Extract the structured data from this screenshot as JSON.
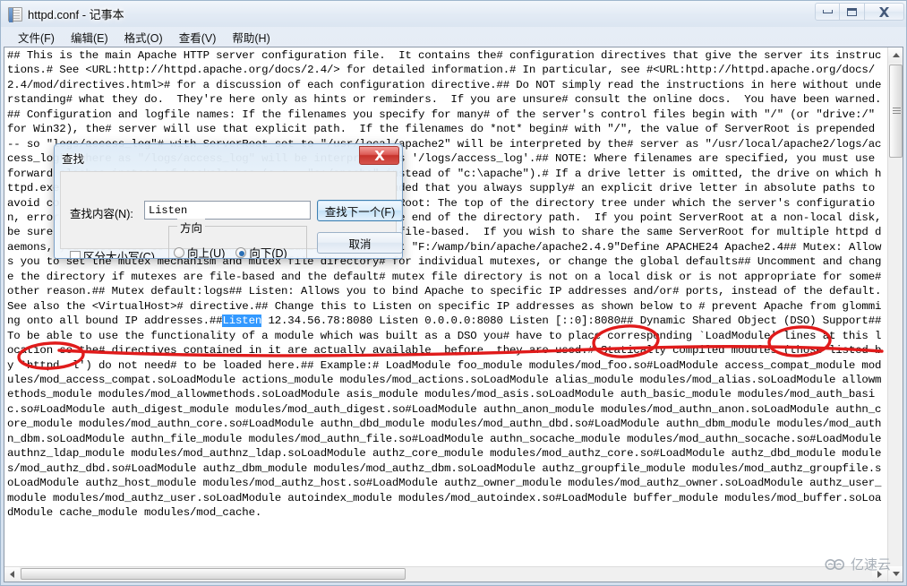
{
  "window": {
    "title": "httpd.conf - 记事本",
    "icon": "notepad-icon",
    "buttons": {
      "minimize": "–",
      "maximize": "□",
      "close": "✕"
    }
  },
  "menubar": {
    "items": [
      {
        "label": "文件(F)",
        "name": "menu-file"
      },
      {
        "label": "编辑(E)",
        "name": "menu-edit"
      },
      {
        "label": "格式(O)",
        "name": "menu-format"
      },
      {
        "label": "查看(V)",
        "name": "menu-view"
      },
      {
        "label": "帮助(H)",
        "name": "menu-help"
      }
    ]
  },
  "editor": {
    "text_before_match": "## This is the main Apache HTTP server configuration file.  It contains the# configuration directives that give the server its instructions.# See <URL:http://httpd.apache.org/docs/2.4/> for detailed information.# In particular, see #<URL:http://httpd.apache.org/docs/2.4/mod/directives.html># for a discussion of each configuration directive.## Do NOT simply read the instructions in here without understanding# what they do.  They're here only as hints or reminders.  If you are unsure# consult the online docs.  You have been warned.  ## Configuration and logfile names: If the filenames you specify for many# of the server's control files begin with \"/\" (or \"drive:/\" for Win32), the# server will use that explicit path.  If the filenames do *not* begin# with \"/\", the value of ServerRoot is prepended -- so \"logs/access_log\"# with ServerRoot set to \"/usr/local/apache2\" will be interpreted by the# server as \"/usr/local/apache2/logs/access_log\", where as \"/logs/access_log\" will be interpreted as '/logs/access_log'.## NOTE: Where filenames are specified, you must use forward slashes instead of backslashes (e.g., \"c:/apache\" instead of \"c:\\apache\").# If a drive letter is omitted, the drive on which httpd.exe is located will be used by default.  It is recommended that you always supply# an explicit drive letter in absolute paths to avoid confusion.ServerSignature OnServerTokens Full## ServerRoot: The top of the directory tree under which the server's configuration, error, and log files are kept.## Do not add a slash at the end of the directory path.  If you point ServerRoot at a non-local disk, be sure to specify a local disk on the# Mutex directive, if file-based.  If you wish to share the same ServerRoot for multiple httpd daemons, you will need to change at# least PidFile.#ServerRoot \"F:/wamp/bin/apache/apache2.4.9\"Define APACHE24 Apache2.4## Mutex: Allows you to set the mutex mechanism and mutex file directory# for individual mutexes, or change the global defaults## Uncomment and change the directory if mutexes are file-based and the default# mutex file directory is not on a local disk or is not appropriate for some# other reason.## Mutex default:logs## Listen: Allows you to bind Apache to specific IP addresses and/or# ports, instead of the default. See also the <VirtualHost># directive.## Change this to Listen on specific IP addresses as shown below to # prevent Apache from glomming onto all bound IP addresses.##",
    "match": "Listen",
    "text_after_match": " 12.34.56.78:8080 Listen 0.0.0.0:8080 Listen [::0]:8080## Dynamic Shared Object (DSO) Support## To be able to use the functionality of a module which was built as a DSO you# have to place corresponding `LoadModule' lines at this location so the# directives contained in it are actually available _before_ they are used.# Statically compiled modules (those listed by `httpd -l') do not need# to be loaded here.## Example:# LoadModule foo_module modules/mod_foo.so#LoadModule access_compat_module modules/mod_access_compat.soLoadModule actions_module modules/mod_actions.soLoadModule alias_module modules/mod_alias.soLoadModule allowmethods_module modules/mod_allowmethods.soLoadModule asis_module modules/mod_asis.soLoadModule auth_basic_module modules/mod_auth_basic.so#LoadModule auth_digest_module modules/mod_auth_digest.so#LoadModule authn_anon_module modules/mod_authn_anon.soLoadModule authn_core_module modules/mod_authn_core.so#LoadModule authn_dbd_module modules/mod_authn_dbd.so#LoadModule authn_dbm_module modules/mod_authn_dbm.soLoadModule authn_file_module modules/mod_authn_file.so#LoadModule authn_socache_module modules/mod_authn_socache.so#LoadModule authnz_ldap_module modules/mod_authnz_ldap.soLoadModule authz_core_module modules/mod_authz_core.so#LoadModule authz_dbd_module modules/mod_authz_dbd.so#LoadModule authz_dbm_module modules/mod_authz_dbm.soLoadModule authz_groupfile_module modules/mod_authz_groupfile.soLoadModule authz_host_module modules/mod_authz_host.so#LoadModule authz_owner_module modules/mod_authz_owner.soLoadModule authz_user_module modules/mod_authz_user.soLoadModule autoindex_module modules/mod_autoindex.so#LoadModule buffer_module modules/mod_buffer.soLoadModule cache_module modules/mod_cache."
  },
  "find_dialog": {
    "title": "查找",
    "close_label": "✕",
    "find_what_label": "查找内容(N):",
    "find_what_value": "Listen",
    "find_next_label": "查找下一个(F)",
    "cancel_label": "取消",
    "direction_group_label": "方向",
    "direction_up_label": "向上(U)",
    "direction_down_label": "向下(D)",
    "direction_selected": "down",
    "match_case_label": "区分大小写(C)",
    "match_case_checked": false
  },
  "annotations": {
    "color": "#e01b1b",
    "shapes": "three red ellipses around :8080 port occurrences plus an underline stroke"
  },
  "watermark": {
    "text": "亿速云",
    "icon": "cloud-icon"
  },
  "scrollbars": {
    "vertical_thumb_position": "near-top",
    "horizontal_thumb_position": "left"
  }
}
